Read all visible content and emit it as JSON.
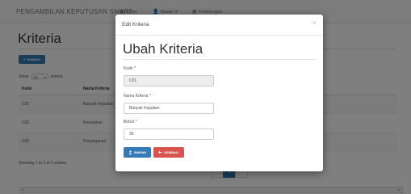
{
  "navbar": {
    "brand": "PENGAMBILAN KEPUTUSAN SMART",
    "links": [
      {
        "icon": "home-icon",
        "glyph": "▦",
        "label": "Home"
      },
      {
        "icon": "user-icon",
        "glyph": "👤",
        "label": "Master ▾"
      },
      {
        "icon": "grid-icon",
        "glyph": "▦",
        "label": "Perhitungan"
      }
    ]
  },
  "page": {
    "title": "Kriteria",
    "add_button": "+ TAMBAH",
    "show_prefix": "Show",
    "show_value": "10",
    "show_suffix": "entries",
    "columns": [
      "Kode",
      "Nama Kriteria"
    ],
    "rows": [
      {
        "kode": "C01",
        "nama": "Banyak Kejadian"
      },
      {
        "kode": "C02",
        "nama": "Kerusakan"
      },
      {
        "kode": "C03",
        "nama": "Penanganan"
      }
    ],
    "showing": "Showing 1 to 3 of 3 entries",
    "pages": [
      "",
      "1",
      ""
    ]
  },
  "modal": {
    "header_title": "Edit Kriteria",
    "close": "×",
    "form_title": "Ubah Kriteria",
    "kode_label": "Kode",
    "kode_value": "C01",
    "nama_label": "Nama Kriteria",
    "nama_value": "Banyak Kejadian",
    "bobot_label": "Bobot",
    "bobot_value": "35",
    "required_mark": "*",
    "save_label": "SIMPAN",
    "back_label": "KEMBALI",
    "save_icon": "save-icon",
    "back_icon": "back-arrow-icon"
  },
  "colors": {
    "primary": "#337ab7",
    "danger": "#d9534f",
    "backdrop": "rgba(0,0,0,0.5)"
  }
}
